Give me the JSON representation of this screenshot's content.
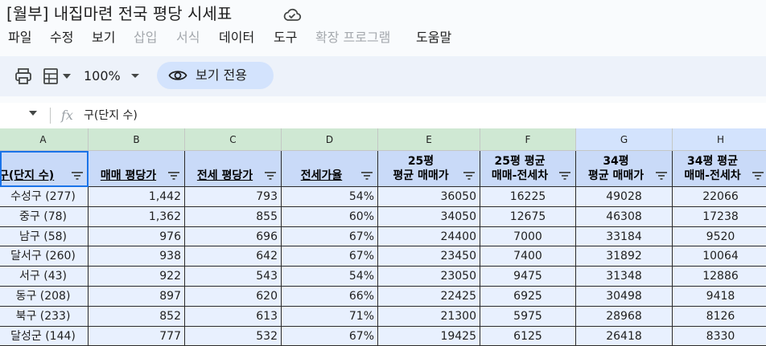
{
  "document": {
    "title": "[월부] 내집마련 전국 평당 시세표",
    "cloud_icon": "cloud-done-icon"
  },
  "menu": [
    "파일",
    "수정",
    "보기",
    "삽입",
    "서식",
    "데이터",
    "도구",
    "확장 프로그램",
    "도움말"
  ],
  "menu_disabled": [
    "삽입",
    "서식",
    "확장 프로그램"
  ],
  "toolbar": {
    "zoom": "100%",
    "view_only_label": "보기 전용"
  },
  "formula_bar": {
    "fx": "fx",
    "content": "구(단지 수)"
  },
  "columns": [
    "A",
    "B",
    "C",
    "D",
    "E",
    "F",
    "G",
    "H"
  ],
  "headers": [
    [
      "구(단지 수)"
    ],
    [
      "매매 평당가"
    ],
    [
      "전세 평당가"
    ],
    [
      "전세가율"
    ],
    [
      "25평",
      "평균 매매가"
    ],
    [
      "25평 평균",
      "매매-전세차"
    ],
    [
      "34평",
      "평균 매매가"
    ],
    [
      "34평 평균",
      "매매-전세차"
    ]
  ],
  "rows": [
    [
      "수성구 (277)",
      "1,442",
      "793",
      "54%",
      "36050",
      "16225",
      "49028",
      "22066"
    ],
    [
      "중구 (78)",
      "1,362",
      "855",
      "60%",
      "34050",
      "12675",
      "46308",
      "17238"
    ],
    [
      "남구 (58)",
      "976",
      "696",
      "67%",
      "24400",
      "7000",
      "33184",
      "9520"
    ],
    [
      "달서구 (260)",
      "938",
      "642",
      "67%",
      "23450",
      "7400",
      "31892",
      "10064"
    ],
    [
      "서구 (43)",
      "922",
      "543",
      "54%",
      "23050",
      "9475",
      "31348",
      "12886"
    ],
    [
      "동구 (208)",
      "897",
      "620",
      "66%",
      "22425",
      "6925",
      "30498",
      "9418"
    ],
    [
      "북구 (233)",
      "852",
      "613",
      "71%",
      "21300",
      "5975",
      "28968",
      "8126"
    ],
    [
      "달성군 (144)",
      "777",
      "532",
      "67%",
      "19425",
      "6125",
      "26418",
      "8330"
    ]
  ],
  "colors": {
    "accent": "#1a73e8",
    "header_fill": "#c9daf8",
    "cell_fill": "#e8f0fe",
    "toolbar_bg": "#edf2fa"
  }
}
